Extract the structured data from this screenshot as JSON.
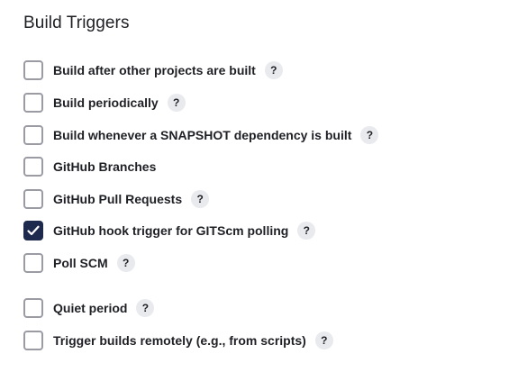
{
  "section": {
    "title": "Build Triggers"
  },
  "triggers": [
    {
      "label": "Build after other projects are built",
      "checked": false,
      "help": "?"
    },
    {
      "label": "Build periodically",
      "checked": false,
      "help": "?"
    },
    {
      "label": "Build whenever a SNAPSHOT dependency is built",
      "checked": false,
      "help": "?"
    },
    {
      "label": "GitHub Branches",
      "checked": false
    },
    {
      "label": "GitHub Pull Requests",
      "checked": false,
      "help": "?"
    },
    {
      "label": "GitHub hook trigger for GITScm polling",
      "checked": true,
      "help": "?"
    },
    {
      "label": "Poll SCM",
      "checked": false,
      "help": "?"
    },
    {
      "label": "Quiet period",
      "checked": false,
      "help": "?"
    },
    {
      "label": "Trigger builds remotely (e.g., from scripts)",
      "checked": false,
      "help": "?"
    }
  ],
  "colors": {
    "checkbox_checked": "#1d2a4e",
    "checkbox_border": "#9a9ba3",
    "help_bg": "#e9eaee",
    "text": "#1f2025"
  }
}
